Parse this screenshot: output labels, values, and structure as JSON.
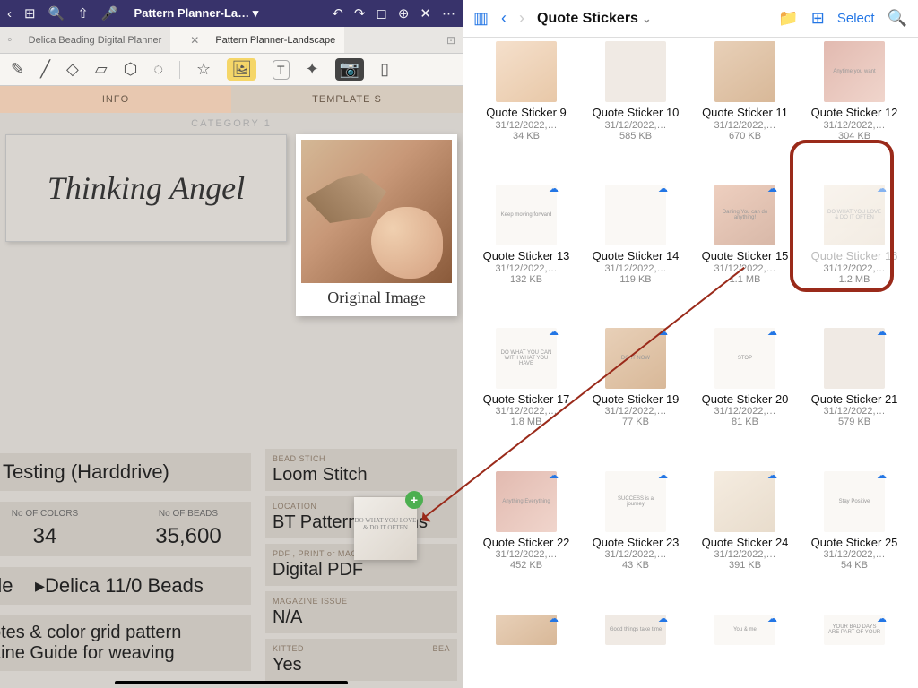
{
  "left": {
    "doc_title": "Pattern Planner-La… ▾",
    "tabs": {
      "inactive": "Delica Beading Digital Planner",
      "active": "Pattern Planner-Landscape"
    },
    "section_tabs": {
      "info": "INFO",
      "templates": "TEMPLATE S"
    },
    "category": "CATEGORY 1",
    "title_card": "Thinking Angel",
    "polaroid_caption": "Original Image",
    "leftcol": {
      "testing": "r Testing (Harddrive)",
      "colors": {
        "h": "No OF COLORS",
        "v": "34"
      },
      "beads": {
        "h": "No OF BEADS",
        "v": "35,600"
      },
      "de": "de",
      "delica": "▸Delica 11/0 Beads",
      "notes1": "otes & color grid pattern",
      "notes2": "Line Guide for weaving"
    },
    "fields": {
      "bead_stitch": {
        "label": "BEAD STICH",
        "val": "Loom Stitch"
      },
      "location": {
        "label": "LOCATION",
        "val": "BT Pattern Designs"
      },
      "pdf": {
        "label": "PDF , PRINT or MAG",
        "val": "Digital PDF"
      },
      "mag": {
        "label": "MAGAZINE ISSUE",
        "val": "N/A"
      },
      "kitted": {
        "label": "KITTED",
        "val": "Yes",
        "rlabel": "BEA"
      }
    },
    "drag_text": "DO WHAT YOU LOVE & DO IT OFTEN"
  },
  "right": {
    "title": "Quote Stickers",
    "select": "Select",
    "items": [
      {
        "name": "Quote Sticker 9",
        "date": "31/12/2022,…",
        "size": "34 KB",
        "th": "t1",
        "txt": ""
      },
      {
        "name": "Quote Sticker 10",
        "date": "31/12/2022,…",
        "size": "585 KB",
        "th": "t2",
        "txt": ""
      },
      {
        "name": "Quote Sticker 11",
        "date": "31/12/2022,…",
        "size": "670 KB",
        "th": "t3",
        "txt": ""
      },
      {
        "name": "Quote Sticker 12",
        "date": "31/12/2022,…",
        "size": "304 KB",
        "th": "t4",
        "txt": "Anytime you want"
      },
      {
        "name": "Quote Sticker 13",
        "date": "31/12/2022,…",
        "size": "132 KB",
        "th": "t5",
        "txt": "Keep moving forward"
      },
      {
        "name": "Quote Sticker 14",
        "date": "31/12/2022,…",
        "size": "119 KB",
        "th": "t5",
        "txt": ""
      },
      {
        "name": "Quote Sticker 15",
        "date": "31/12/2022,…",
        "size": "1.1 MB",
        "th": "t7",
        "txt": "Darling You can do anything!"
      },
      {
        "name": "Quote Sticker 16",
        "date": "31/12/2022,…",
        "size": "1.2 MB",
        "th": "t6",
        "txt": "DO WHAT YOU LOVE & DO IT OFTEN",
        "sel": true
      },
      {
        "name": "Quote Sticker 17",
        "date": "31/12/2022,…",
        "size": "1.8 MB",
        "th": "t5",
        "txt": "DO WHAT YOU CAN WITH WHAT YOU HAVE"
      },
      {
        "name": "Quote Sticker 19",
        "date": "31/12/2022,…",
        "size": "77 KB",
        "th": "t3",
        "txt": "DO IT NOW"
      },
      {
        "name": "Quote Sticker 20",
        "date": "31/12/2022,…",
        "size": "81 KB",
        "th": "t5",
        "txt": "STOP"
      },
      {
        "name": "Quote Sticker 21",
        "date": "31/12/2022,…",
        "size": "579 KB",
        "th": "t2",
        "txt": ""
      },
      {
        "name": "Quote Sticker 22",
        "date": "31/12/2022,…",
        "size": "452 KB",
        "th": "t4",
        "txt": "Anything Everything"
      },
      {
        "name": "Quote Sticker 23",
        "date": "31/12/2022,…",
        "size": "43 KB",
        "th": "t5",
        "txt": "SUCCESS is a journey"
      },
      {
        "name": "Quote Sticker 24",
        "date": "31/12/2022,…",
        "size": "391 KB",
        "th": "t6",
        "txt": ""
      },
      {
        "name": "Quote Sticker 25",
        "date": "31/12/2022,…",
        "size": "54 KB",
        "th": "t5",
        "txt": "Stay Positive"
      },
      {
        "name": "",
        "date": "",
        "size": "",
        "th": "t3",
        "txt": ""
      },
      {
        "name": "",
        "date": "",
        "size": "",
        "th": "t2",
        "txt": "Good things take time"
      },
      {
        "name": "",
        "date": "",
        "size": "",
        "th": "t5",
        "txt": "You & me"
      },
      {
        "name": "",
        "date": "",
        "size": "",
        "th": "t5",
        "txt": "YOUR BAD DAYS ARE PART OF YOUR"
      }
    ]
  },
  "annotation": {
    "highlight_item": "Quote Sticker 16"
  }
}
